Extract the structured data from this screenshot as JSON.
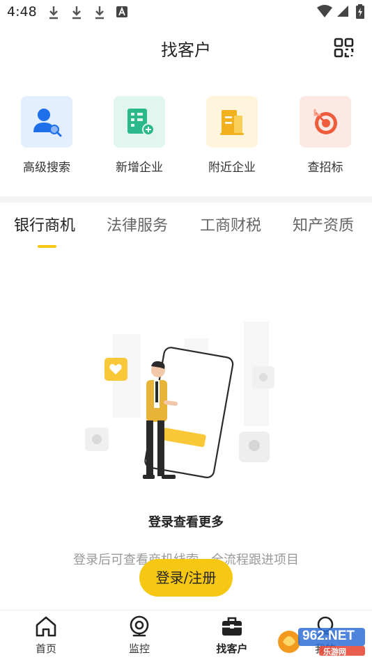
{
  "status_bar": {
    "time": "4:48",
    "icons": [
      "download-icon",
      "download-icon",
      "download-icon",
      "a-notification-icon",
      "wifi-icon",
      "signal-icon",
      "battery-icon"
    ]
  },
  "header": {
    "title": "找客户",
    "right_icon": "grid-apps-icon"
  },
  "quick_actions": [
    {
      "label": "高级搜索",
      "icon": "user-search-icon",
      "bg": "#e3eeff",
      "accent": "#1f6feb"
    },
    {
      "label": "新增企业",
      "icon": "new-company-icon",
      "bg": "#e1f6ef",
      "accent": "#2bb88a"
    },
    {
      "label": "附近企业",
      "icon": "nearby-building-icon",
      "bg": "#fff4dc",
      "accent": "#f2b01c"
    },
    {
      "label": "查招标",
      "icon": "target-icon",
      "bg": "#fde9e4",
      "accent": "#ef5c3c"
    }
  ],
  "tabs": [
    {
      "label": "银行商机",
      "active": true
    },
    {
      "label": "法律服务",
      "active": false
    },
    {
      "label": "工商财税",
      "active": false
    },
    {
      "label": "知产资质",
      "active": false
    }
  ],
  "empty_state": {
    "title": "登录查看更多",
    "description": "登录后可查看商机线索，全流程跟进项目",
    "button_label": "登录/注册"
  },
  "bottom_nav": [
    {
      "label": "首页",
      "icon": "home-icon",
      "active": false
    },
    {
      "label": "监控",
      "icon": "camera-monitor-icon",
      "active": false
    },
    {
      "label": "找客户",
      "icon": "briefcase-icon",
      "active": true
    },
    {
      "label": "我的",
      "icon": "profile-icon",
      "active": false
    }
  ],
  "watermark": {
    "brand": "962.NET",
    "subtitle": "乐游网"
  },
  "colors": {
    "accent": "#f7c813",
    "text_primary": "#222222",
    "text_secondary": "#999999"
  }
}
